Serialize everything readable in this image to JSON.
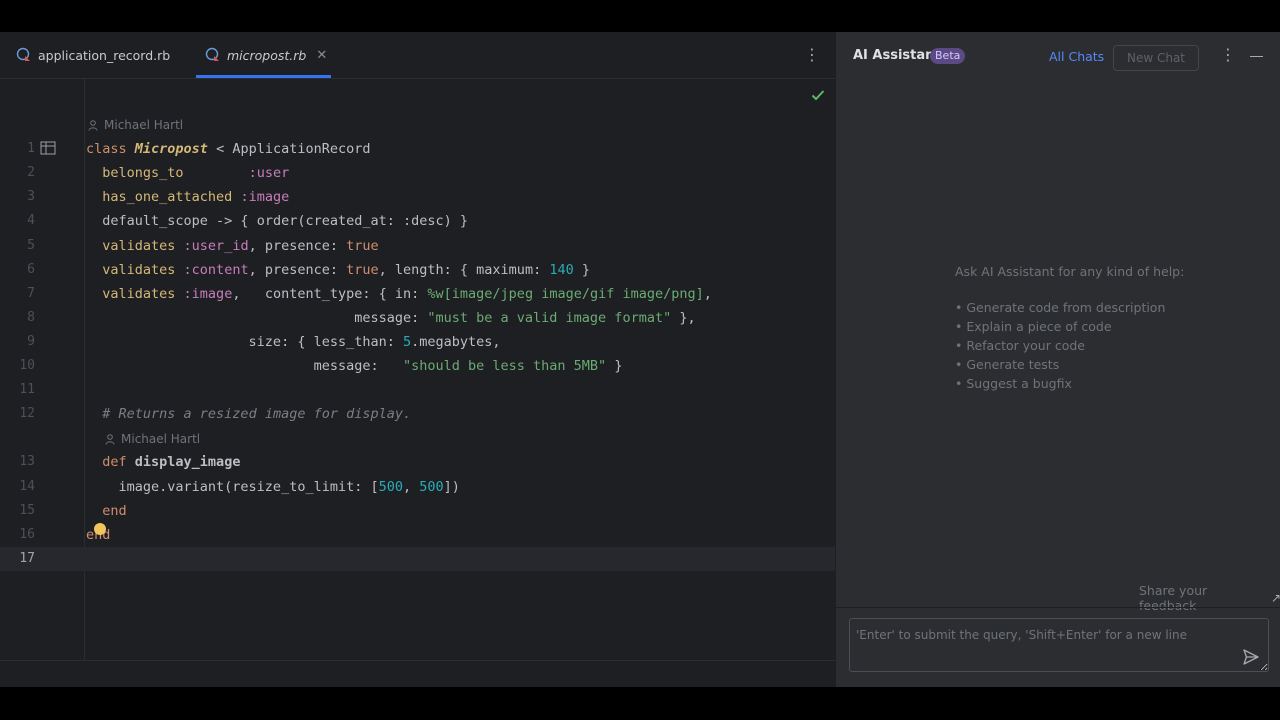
{
  "tabs": [
    {
      "label": "application_record.rb",
      "active": false
    },
    {
      "label": "micropost.rb",
      "active": true
    }
  ],
  "editor": {
    "author_annotation": "Michael Hartl",
    "line_numbers": [
      "1",
      "2",
      "3",
      "4",
      "5",
      "6",
      "7",
      "8",
      "9",
      "10",
      "11",
      "12",
      "13",
      "14",
      "15",
      "16",
      "17"
    ],
    "current_line": "17"
  },
  "code": {
    "l1": {
      "kw": "class",
      "name": "Micropost",
      "rest": " < ApplicationRecord"
    },
    "l2": {
      "meth": "belongs_to",
      "rest": "        :user"
    },
    "l3": {
      "meth": "has_one_attached",
      "rest": " :image"
    },
    "l4": {
      "text": "default_scope -> { order(created_at: :desc) }"
    },
    "l5": {
      "meth": "validates",
      "sym": " :user_id",
      "rest": ", presence: ",
      "val": "true"
    },
    "l6": {
      "meth": "validates",
      "sym": " :content",
      "rest": ", presence: ",
      "val": "true",
      "rest2": ", length: { maximum: ",
      "num": "140",
      "end": " }"
    },
    "l7": {
      "meth": "validates",
      "sym": " :image",
      "rest": ",   content_type: { in: ",
      "str": "%w[image/jpeg image/gif image/png]",
      "end": ","
    },
    "l8": {
      "pre": "                                 message: ",
      "str": "\"must be a valid image format\"",
      "end": " },"
    },
    "l9": {
      "pre": "                    size: { less_than: ",
      "num": "5",
      "end": ".megabytes,"
    },
    "l10": {
      "pre": "                            message:   ",
      "str": "\"should be less than 5MB\"",
      "end": " }"
    },
    "l12": {
      "comment": "# Returns a resized image for display."
    },
    "l13": {
      "kw": "def",
      "name": " display_image"
    },
    "l14": {
      "pre": "    image.variant(resize_to_limit: [",
      "n1": "500",
      "mid": ", ",
      "n2": "500",
      "end": "])"
    },
    "l15": {
      "kw": "end"
    },
    "l16": {
      "kw": "end"
    }
  },
  "ai": {
    "title": "AI Assistant",
    "badge": "Beta",
    "all_chats": "All Chats",
    "new_chat": "New Chat",
    "ask": "Ask AI Assistant for any kind of help:",
    "items": [
      "• Generate code from description",
      "• Explain a piece of code",
      "• Refactor your code",
      "• Generate tests",
      "• Suggest a bugfix"
    ],
    "feedback": "Share your feedback",
    "input_placeholder": "'Enter' to submit the query, 'Shift+Enter' for a new line"
  },
  "icons": {
    "file": "ruby-file-icon",
    "check": "check-icon",
    "send": "send-icon",
    "bulb": "lightbulb-icon"
  },
  "colors": {
    "accent": "#3574f0",
    "keyword": "#cf8e6d",
    "string": "#6aab73",
    "number": "#2aacb8",
    "symbol": "#c77dbb",
    "method": "#d5b778"
  }
}
